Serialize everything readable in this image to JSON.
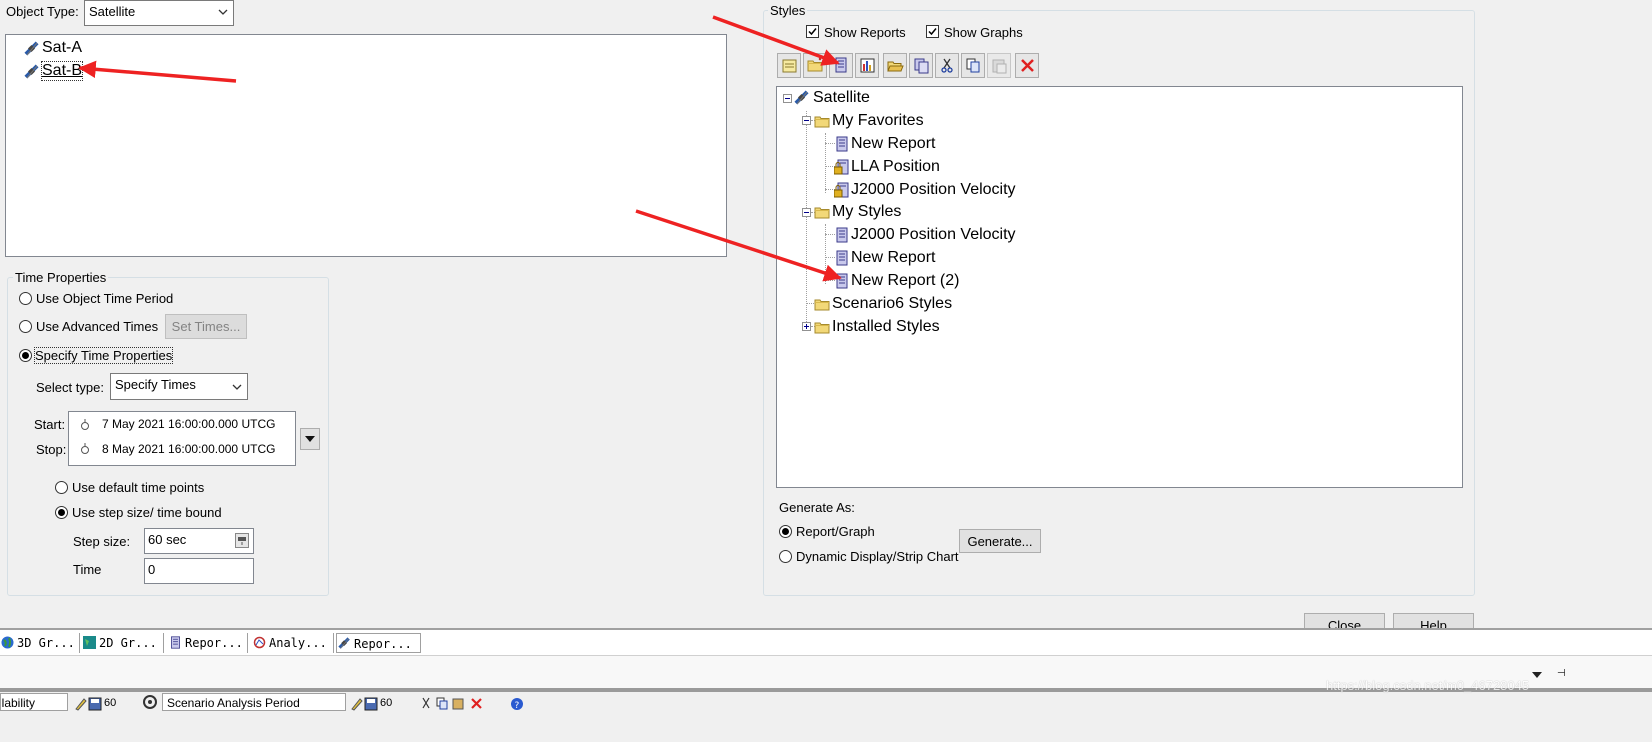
{
  "object_type": {
    "label": "Object Type:",
    "value": "Satellite"
  },
  "objects": [
    {
      "name": "Sat-A"
    },
    {
      "name": "Sat-B"
    }
  ],
  "time_properties": {
    "title": "Time Properties",
    "use_object_time_period": "Use Object Time Period",
    "use_advanced_times": "Use Advanced Times",
    "set_times_button": "Set Times...",
    "specify_time_properties": "Specify Time Properties",
    "select_type_label": "Select type:",
    "select_type_value": "Specify Times",
    "start_label": "Start:",
    "start_value": "7 May 2021 16:00:00.000 UTCG",
    "stop_label": "Stop:",
    "stop_value": "8 May 2021 16:00:00.000 UTCG",
    "use_default_time_points": "Use default time points",
    "use_step_size": "Use step size/ time bound",
    "step_size_label": "Step size:",
    "step_size_value": "60 sec",
    "time_label": "Time",
    "time_value": "0"
  },
  "styles": {
    "title": "Styles",
    "show_reports": "Show Reports",
    "show_graphs": "Show Graphs",
    "tree": {
      "root": "Satellite",
      "my_favorites": "My Favorites",
      "fav_items": [
        "New Report",
        "LLA Position",
        "J2000 Position Velocity"
      ],
      "my_styles": "My Styles",
      "style_items": [
        "J2000 Position Velocity",
        "New Report",
        "New Report (2)"
      ],
      "scenario_styles": "Scenario6 Styles",
      "installed_styles": "Installed Styles"
    }
  },
  "generate": {
    "label": "Generate As:",
    "report_graph": "Report/Graph",
    "dynamic_display": "Dynamic Display/Strip Chart",
    "button": "Generate..."
  },
  "dialog_buttons": {
    "close": "Close",
    "help": "Help"
  },
  "taskbar_tabs": [
    "3D Gr...",
    "2D Gr...",
    "Repor...",
    "Analy...",
    "Repor..."
  ],
  "status_strip": {
    "left": "ilability",
    "scenario": "Scenario Analysis Period",
    "num1": "60",
    "num2": "60"
  },
  "watermark": "https://blog.csdn.net/m0_46728045",
  "colors": {
    "annotation_arrow": "#ee2222",
    "report_icon": "#4a4aa8",
    "folder": "#f2d878"
  }
}
